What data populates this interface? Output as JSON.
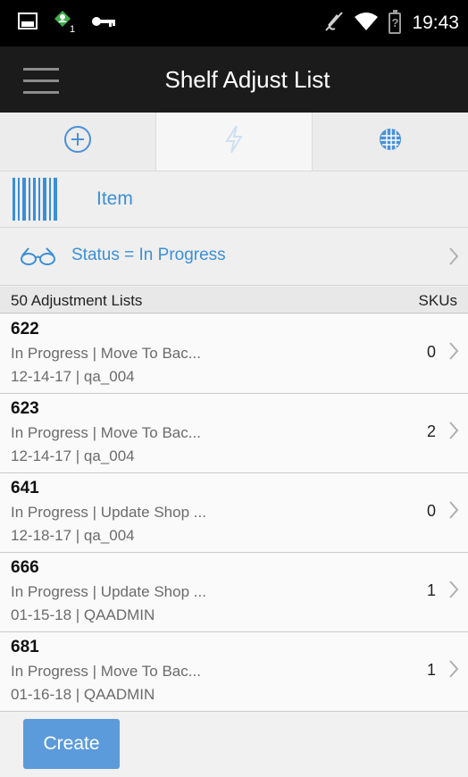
{
  "status_bar": {
    "time": "19:43",
    "battery_label": "?",
    "icons": [
      "image-icon",
      "person-notification-icon",
      "key-icon",
      "mute-icon",
      "wifi-icon",
      "battery-icon"
    ]
  },
  "app_bar": {
    "title": "Shelf Adjust List"
  },
  "tabs": [
    {
      "icon": "add-circle-icon",
      "active": false
    },
    {
      "icon": "lightning-icon",
      "active": true
    },
    {
      "icon": "cube-icon",
      "active": false
    }
  ],
  "item_scan": {
    "label": "Item",
    "icon": "barcode-icon"
  },
  "filter": {
    "label": "Status = In Progress",
    "icon": "glasses-icon"
  },
  "list_header": {
    "count_label": "50 Adjustment Lists",
    "skus_label": "SKUs"
  },
  "rows": [
    {
      "id": "622",
      "desc": "In Progress | Move To Bac...",
      "meta": "12-14-17 | qa_004",
      "skus": "0"
    },
    {
      "id": "623",
      "desc": "In Progress | Move To Bac...",
      "meta": "12-14-17 | qa_004",
      "skus": "2"
    },
    {
      "id": "641",
      "desc": "In Progress | Update Shop ...",
      "meta": "12-18-17 | qa_004",
      "skus": "0"
    },
    {
      "id": "666",
      "desc": "In Progress | Update Shop ...",
      "meta": "01-15-18 | QAADMIN",
      "skus": "1"
    },
    {
      "id": "681",
      "desc": "In Progress | Move To Bac...",
      "meta": "01-16-18 | QAADMIN",
      "skus": "1"
    }
  ],
  "actions": {
    "create_label": "Create"
  },
  "colors": {
    "accent": "#3b8fd6",
    "button": "#5c9bdb",
    "app_bar": "#1b1b1b"
  }
}
